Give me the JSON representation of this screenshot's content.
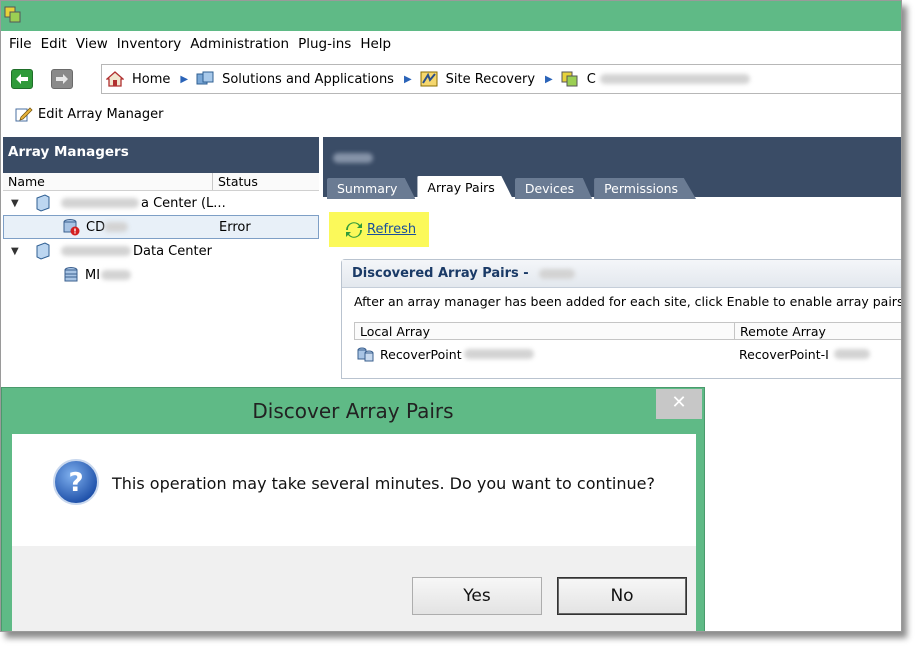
{
  "menu": [
    "File",
    "Edit",
    "View",
    "Inventory",
    "Administration",
    "Plug-ins",
    "Help"
  ],
  "breadcrumb": {
    "home": "Home",
    "solutions": "Solutions and Applications",
    "site_recovery": "Site Recovery",
    "current": "C"
  },
  "toolbar": {
    "edit_array_manager": "Edit Array Manager"
  },
  "left_panel": {
    "title": "Array Managers",
    "columns": {
      "name": "Name",
      "status": "Status"
    },
    "tree": [
      {
        "label_tail": "a Center (L...",
        "status": ""
      },
      {
        "label": "CD",
        "status": "Error"
      },
      {
        "label_tail": "Data Center",
        "status": ""
      },
      {
        "label": "MI",
        "status": ""
      }
    ]
  },
  "right_panel": {
    "tabs": [
      "Summary",
      "Array Pairs",
      "Devices",
      "Permissions"
    ],
    "active_tab": "Array Pairs",
    "refresh": "Refresh",
    "discovered": {
      "title": "Discovered Array Pairs -",
      "description": "After an array manager has been added for each site, click Enable to enable array pairs for use w",
      "columns": {
        "local": "Local Array",
        "remote": "Remote Array"
      },
      "row": {
        "local": "RecoverPoint",
        "remote": "RecoverPoint-I"
      }
    }
  },
  "dialog": {
    "title": "Discover Array Pairs",
    "close": "✕",
    "message": "This operation may take several minutes. Do you want to continue?",
    "yes": "Yes",
    "no": "No"
  },
  "colors": {
    "title_green": "#5fba86",
    "panel_header": "#3a4c66",
    "tab_inactive": "#6a7b93",
    "refresh_highlight": "#fbf95a",
    "link_blue": "#1a4f9c"
  }
}
